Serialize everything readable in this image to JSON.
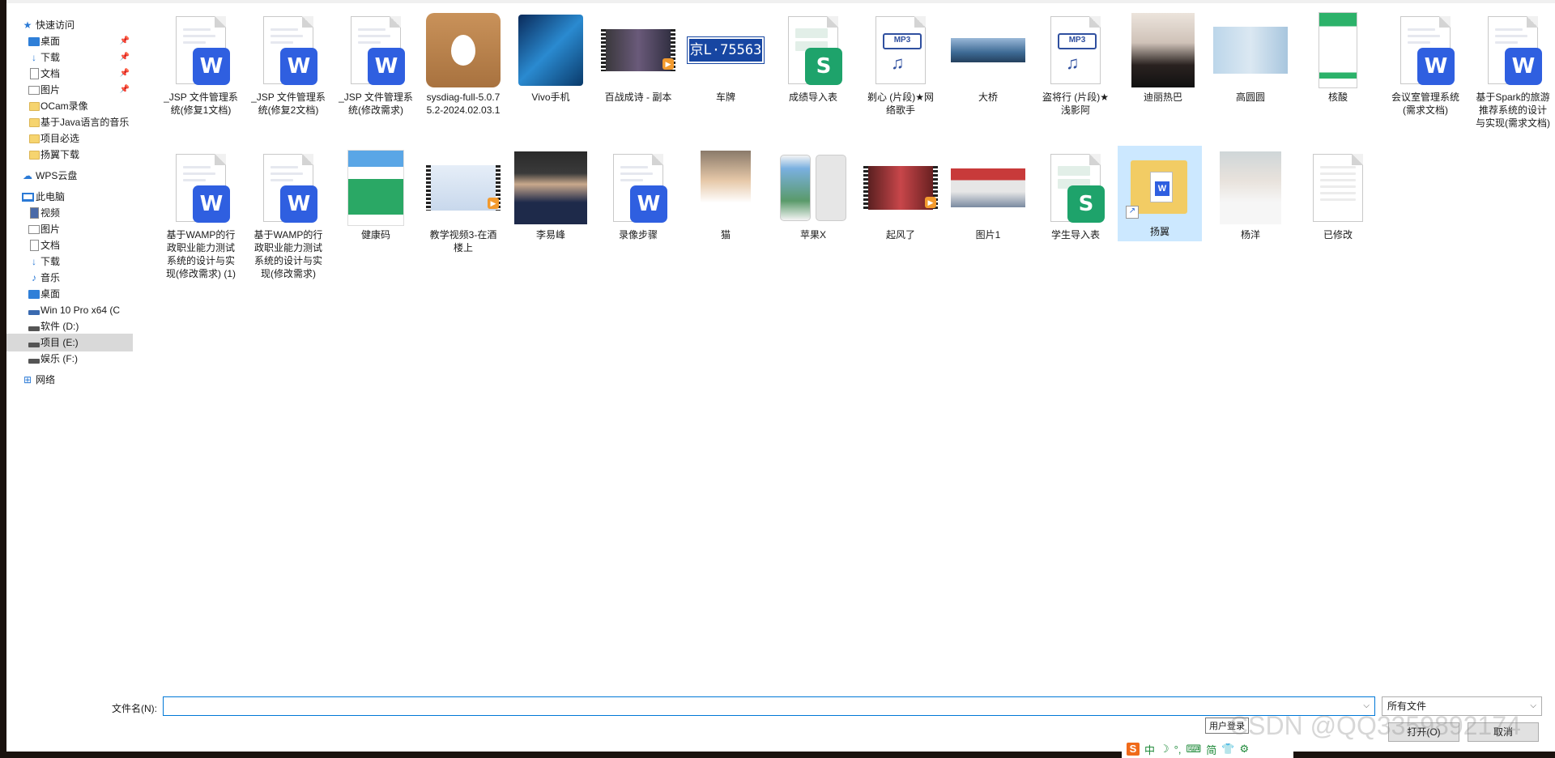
{
  "nav": {
    "quick_access": "快速访问",
    "items": [
      {
        "label": "桌面",
        "pinned": true
      },
      {
        "label": "下载",
        "pinned": true
      },
      {
        "label": "文档",
        "pinned": true
      },
      {
        "label": "图片",
        "pinned": true
      },
      {
        "label": "OCam录像",
        "pinned": false
      },
      {
        "label": "基于Java语言的音乐",
        "pinned": false
      },
      {
        "label": "项目必选",
        "pinned": false
      },
      {
        "label": "扬翼下载",
        "pinned": false
      }
    ],
    "wps_cloud": "WPS云盘",
    "this_pc": "此电脑",
    "pc_items": [
      "视频",
      "图片",
      "文档",
      "下载",
      "音乐",
      "桌面"
    ],
    "drives": [
      "Win 10 Pro x64 (C",
      "软件 (D:)",
      "项目 (E:)",
      "娱乐 (F:)"
    ],
    "selected_drive": "项目 (E:)",
    "network": "网络",
    "pin_glyph": "📌"
  },
  "files_row1": [
    {
      "name": "_JSP 文件管理系统(修复1文档)",
      "type": "word"
    },
    {
      "name": "_JSP 文件管理系统(修复2文档)",
      "type": "word"
    },
    {
      "name": "_JSP 文件管理系统(修改需求)",
      "type": "word"
    },
    {
      "name": "sysdiag-full-5.0.75.2-2024.02.03.1",
      "type": "installer"
    },
    {
      "name": "Vivo手机",
      "type": "image"
    },
    {
      "name": "百战成诗 - 副本",
      "type": "video"
    },
    {
      "name": "车牌",
      "type": "image"
    },
    {
      "name": "成绩导入表",
      "type": "sheet"
    },
    {
      "name": "剃心 (片段)★网络歌手",
      "type": "mp3"
    },
    {
      "name": "大桥",
      "type": "image"
    },
    {
      "name": "盗将行 (片段)★浅影阿",
      "type": "mp3"
    },
    {
      "name": "迪丽热巴",
      "type": "image"
    },
    {
      "name": "高圆圆",
      "type": "image"
    },
    {
      "name": "核酸",
      "type": "image"
    },
    {
      "name": "会议室管理系统(需求文档)",
      "type": "word"
    },
    {
      "name": "基于Spark的旅游推荐系统的设计与实现(需求文档)",
      "type": "word"
    }
  ],
  "files_row2": [
    {
      "name": "基于WAMP的行政职业能力测试系统的设计与实现(修改需求) (1)",
      "type": "word"
    },
    {
      "name": "基于WAMP的行政职业能力测试系统的设计与实现(修改需求)",
      "type": "word"
    },
    {
      "name": "健康码",
      "type": "image"
    },
    {
      "name": "教学视频3-在酒楼上",
      "type": "video"
    },
    {
      "name": "李易峰",
      "type": "image"
    },
    {
      "name": "录像步骤",
      "type": "word"
    },
    {
      "name": "猫",
      "type": "image"
    },
    {
      "name": "苹果X",
      "type": "image"
    },
    {
      "name": "起风了",
      "type": "video"
    },
    {
      "name": "图片1",
      "type": "image"
    },
    {
      "name": "学生导入表",
      "type": "sheet"
    },
    {
      "name": "扬翼",
      "type": "folder-shortcut",
      "selected": true
    },
    {
      "name": "杨洋",
      "type": "image"
    },
    {
      "name": "已修改",
      "type": "blank"
    }
  ],
  "thumb_text": {
    "word_badge": "W",
    "sheet_badge": "S",
    "mp3_badge": "MP3",
    "note": "♫",
    "plate": "京L·75563",
    "shortcut": "↗",
    "play": "▶",
    "doc_badge": "W"
  },
  "footer": {
    "filename_label": "文件名(N):",
    "filename_value": "",
    "filetype": "所有文件",
    "open_button": "打开(O)",
    "cancel_button": "取消",
    "tooltip": "用户登录",
    "caret": "⌵"
  },
  "ime": {
    "items": [
      "中",
      "☽",
      "°,",
      "⌨",
      "简",
      "👕",
      "⚙"
    ],
    "logo": "S"
  },
  "watermark": "CSDN @QQ3359892174",
  "colors": {
    "word": "#2f5fe0",
    "sheet": "#1ea36b",
    "selection": "#cce8ff",
    "accent": "#0078d7"
  }
}
